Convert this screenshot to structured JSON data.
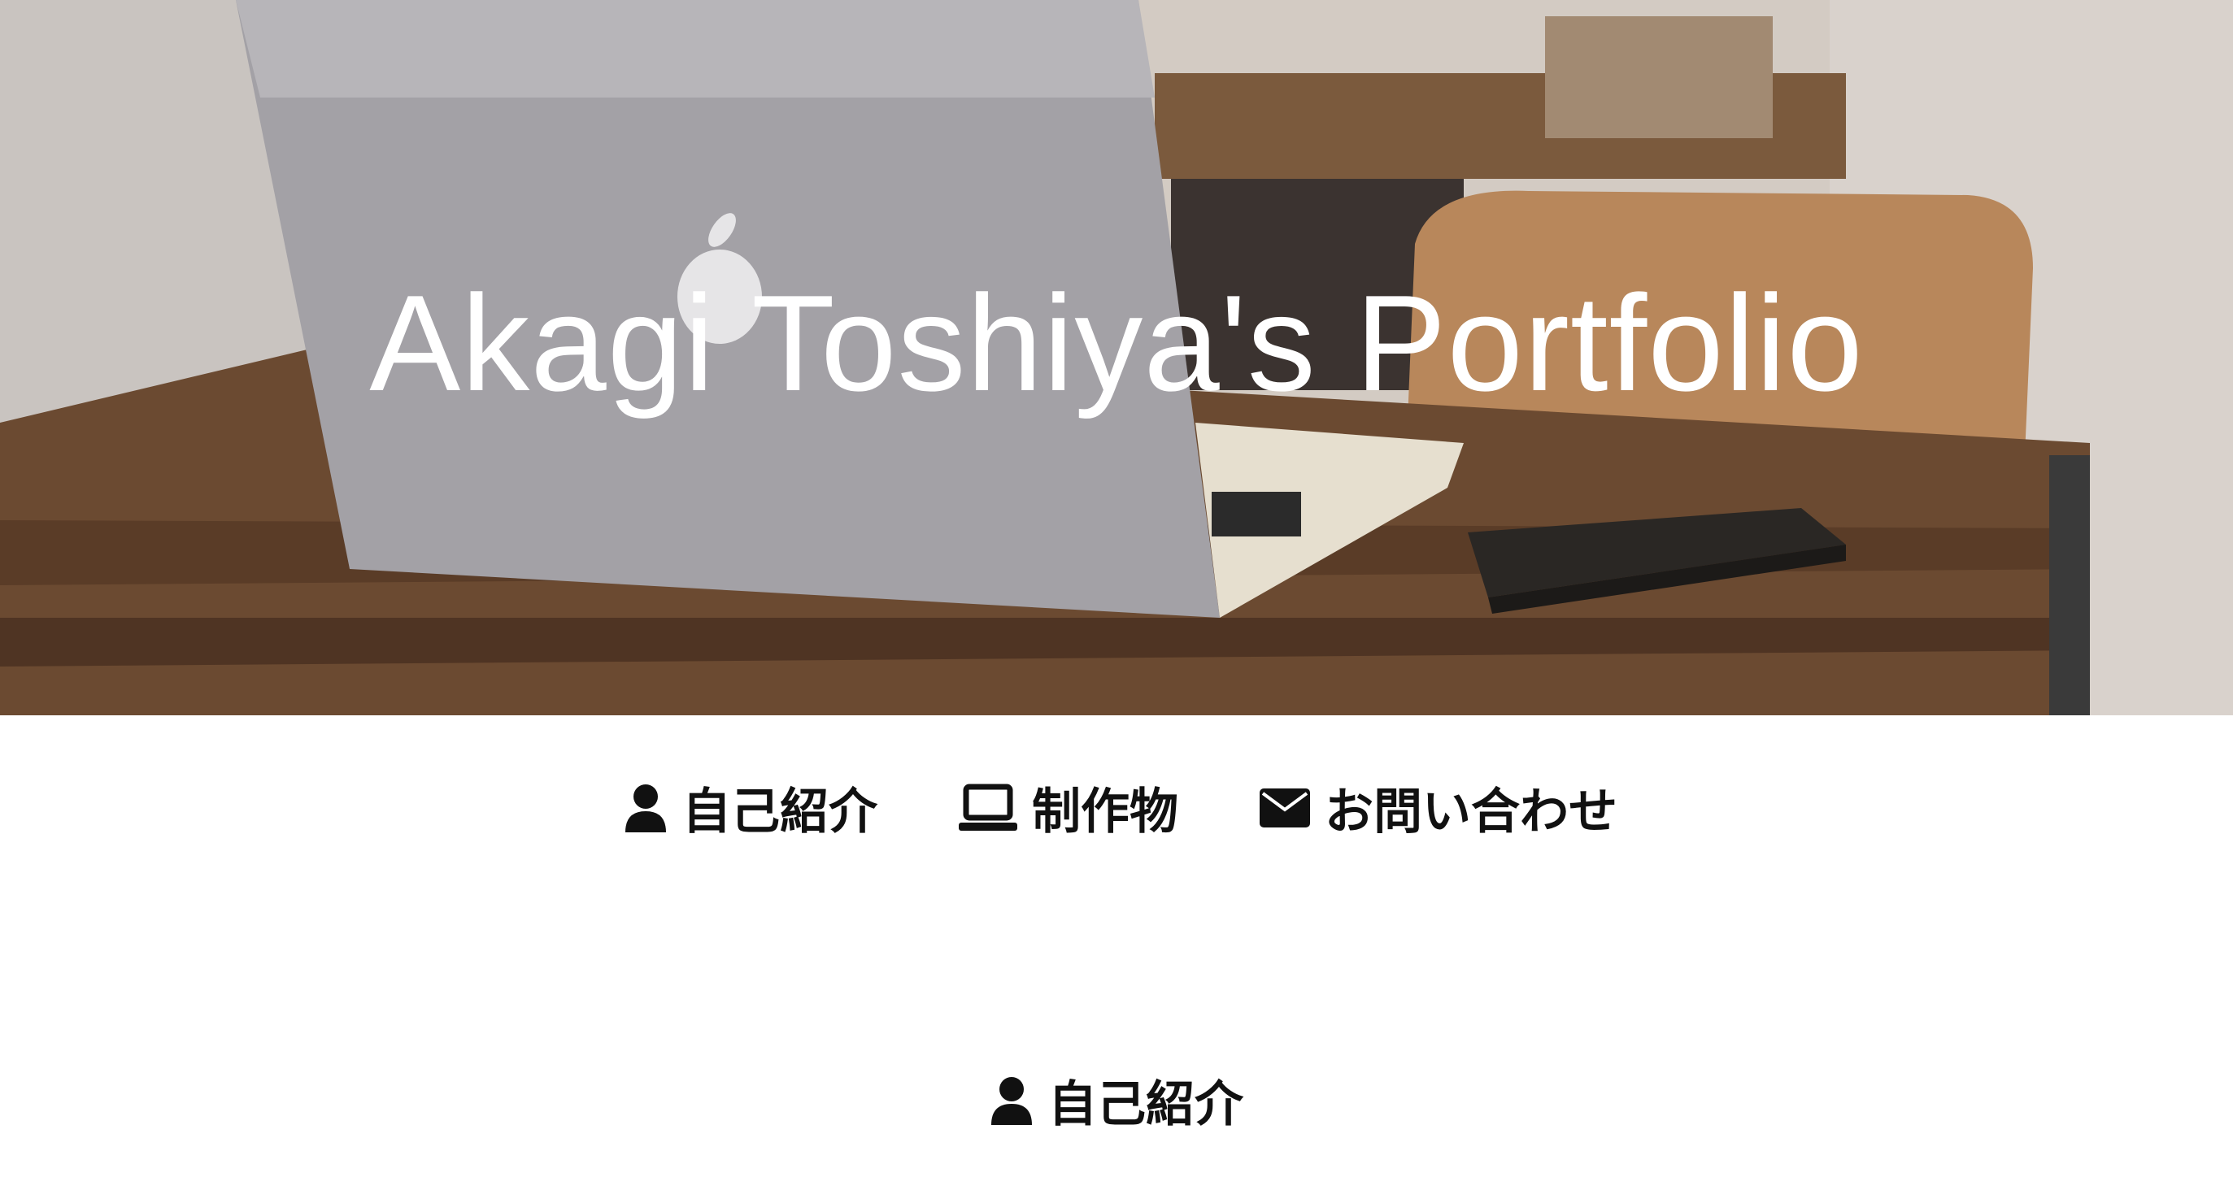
{
  "hero": {
    "title": "Akagi Toshiya's Portfolio",
    "image": "laptop-on-wooden-desk-photo"
  },
  "nav": {
    "items": [
      {
        "label": "自己紹介",
        "icon": "user-icon"
      },
      {
        "label": "制作物",
        "icon": "laptop-icon"
      },
      {
        "label": "お問い合わせ",
        "icon": "envelope-icon"
      }
    ]
  },
  "section": {
    "heading": "自己紹介",
    "icon": "user-icon"
  },
  "colors": {
    "text": "#111111",
    "hero_title": "#ffffff",
    "background": "#ffffff"
  }
}
